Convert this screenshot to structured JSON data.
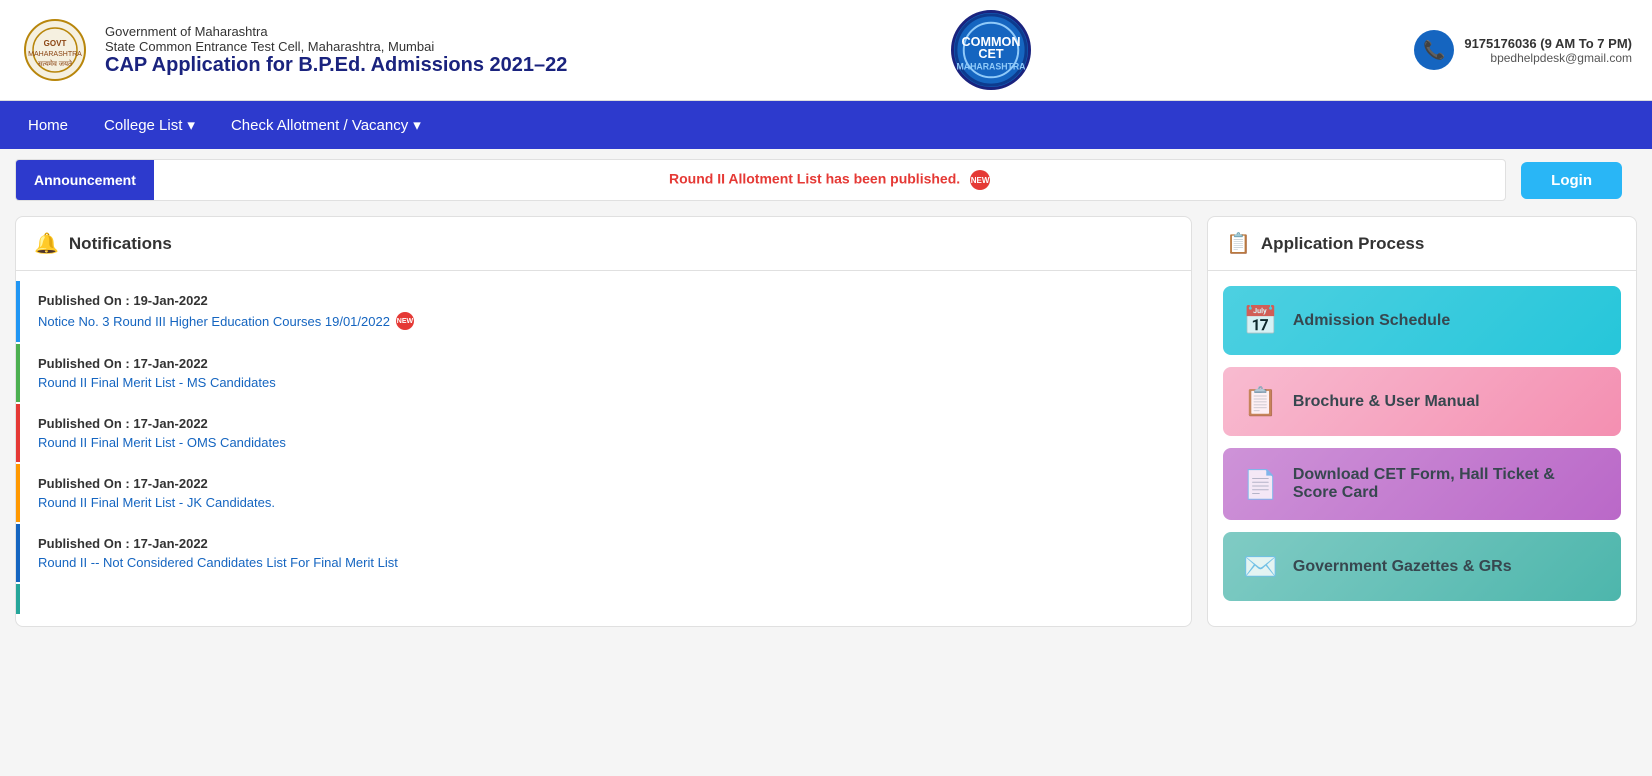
{
  "header": {
    "line1": "Government of Maharashtra",
    "line2": "State Common Entrance Test Cell, Maharashtra, Mumbai",
    "title": "CAP Application for B.P.Ed. Admissions 2021–22",
    "cet_logo_text": "CET",
    "phone": "9175176036 (9 AM To 7 PM)",
    "email": "bpedhelpdesk@gmail.com"
  },
  "navbar": {
    "items": [
      {
        "label": "Home",
        "has_dropdown": false
      },
      {
        "label": "College List",
        "has_dropdown": true
      },
      {
        "label": "Check Allotment / Vacancy",
        "has_dropdown": true
      }
    ]
  },
  "announcement": {
    "label": "Announcement",
    "text": "Round II Allotment List has been published.",
    "new": true
  },
  "login_button": "Login",
  "notifications": {
    "title": "Notifications",
    "items": [
      {
        "date": "Published On : 19-Jan-2022",
        "text": "Notice No. 3 Round III Higher Education Courses 19/01/2022",
        "is_new": true,
        "color": "blue"
      },
      {
        "date": "Published On : 17-Jan-2022",
        "text": "Round II Final Merit List - MS Candidates",
        "is_new": false,
        "color": "green"
      },
      {
        "date": "Published On : 17-Jan-2022",
        "text": "Round II Final Merit List - OMS Candidates",
        "is_new": false,
        "color": "red"
      },
      {
        "date": "Published On : 17-Jan-2022",
        "text": "Round II Final Merit List - JK Candidates.",
        "is_new": false,
        "color": "orange"
      },
      {
        "date": "Published On : 17-Jan-2022",
        "text": "Round II -- Not Considered Candidates List For Final Merit List",
        "is_new": false,
        "color": "dark-blue"
      },
      {
        "date": "",
        "text": "",
        "is_new": false,
        "color": "teal"
      }
    ]
  },
  "application_process": {
    "title": "Application Process",
    "buttons": [
      {
        "label": "Admission Schedule",
        "icon": "📅",
        "style": "cyan"
      },
      {
        "label": "Brochure & User Manual",
        "icon": "📋",
        "style": "pink"
      },
      {
        "label": "Download CET Form, Hall Ticket & Score Card",
        "icon": "📄",
        "style": "purple"
      },
      {
        "label": "Government Gazettes & GRs",
        "icon": "✉️",
        "style": "teal"
      }
    ]
  }
}
